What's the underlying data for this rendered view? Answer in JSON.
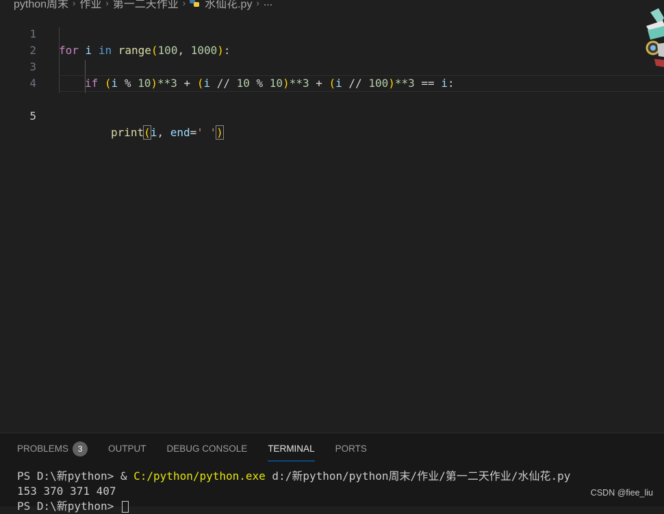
{
  "breadcrumb": {
    "items": [
      "python周末",
      "作业",
      "第一二天作业"
    ],
    "file": "水仙花.py",
    "trailing": "...",
    "separator": "›"
  },
  "editor": {
    "line_numbers": [
      "1",
      "2",
      "3",
      "4",
      "5"
    ],
    "active_line": "5",
    "code": {
      "l1": {
        "for": "for",
        "i": "i",
        "in": "in",
        "range": "range",
        "lp": "(",
        "a": "100",
        "comma": ", ",
        "b": "1000",
        "rp": ")",
        "colon": ":"
      },
      "l3": {
        "if": "if",
        "p1": "(",
        "i1": "i",
        "mod1": " % ",
        "n10a": "10",
        "c1": ")",
        "pow1": "**3",
        "plus1": " + ",
        "p2": "(",
        "i2": "i",
        "fd1": " // ",
        "n10b": "10",
        "mod2": " % ",
        "n10c": "10",
        "c2": ")",
        "pow2": "**3",
        "plus2": " + ",
        "p3": "(",
        "i3": "i",
        "fd2": " // ",
        "n100": "100",
        "c3": ")",
        "pow3": "**3",
        "eq": " == ",
        "i4": "i",
        "colon": ":"
      },
      "l5": {
        "print": "print",
        "lp": "(",
        "i": "i",
        "comma": ", ",
        "end": "end",
        "eq": "=",
        "str": "' '",
        "rp": ")"
      }
    }
  },
  "panel": {
    "tabs": [
      {
        "label": "PROBLEMS",
        "badge": "3"
      },
      {
        "label": "OUTPUT"
      },
      {
        "label": "DEBUG CONSOLE"
      },
      {
        "label": "TERMINAL",
        "active": true
      },
      {
        "label": "PORTS"
      }
    ],
    "terminal": {
      "prompt1": "PS D:\\新python> ",
      "amp": "& ",
      "exe": "C:/python/python.exe",
      "script": " d:/新python/python周末/作业/第一二天作业/水仙花.py",
      "output": "153 370 371 407",
      "prompt2": "PS D:\\新python> "
    }
  },
  "watermark": "CSDN @fiee_liu",
  "colors": {
    "background": "#1f1f1f",
    "panel": "#181818",
    "keyword_control": "#c586c0",
    "keyword": "#569cd6",
    "function": "#dcdcaa",
    "number": "#b5cea8",
    "variable": "#9cdcfe",
    "string": "#ce9178",
    "accent": "#0078d4"
  }
}
